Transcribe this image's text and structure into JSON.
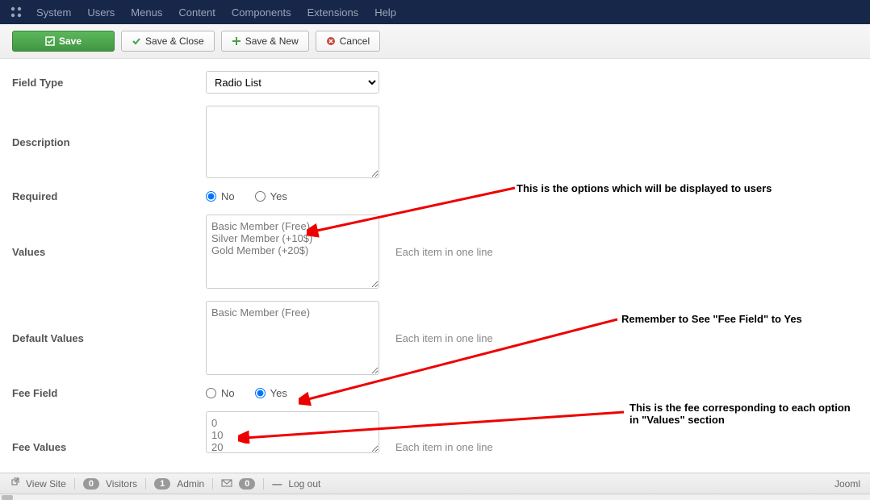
{
  "topmenu": [
    "System",
    "Users",
    "Menus",
    "Content",
    "Components",
    "Extensions",
    "Help"
  ],
  "toolbar": {
    "save": "Save",
    "save_close": "Save & Close",
    "save_new": "Save & New",
    "cancel": "Cancel"
  },
  "form": {
    "field_type_label": "Field Type",
    "field_type_value": "Radio List",
    "description_label": "Description",
    "description_value": "",
    "required_label": "Required",
    "radio_no": "No",
    "radio_yes": "Yes",
    "values_label": "Values",
    "values_value": "Basic Member (Free)\nSilver Member (+10$)\nGold Member (+20$)",
    "hint_each": "Each item in one line",
    "default_label": "Default Values",
    "default_value": "Basic Member (Free)",
    "fee_field_label": "Fee Field",
    "fee_values_label": "Fee Values",
    "fee_values_value": "0\n10\n20"
  },
  "annotations": {
    "a1": "This is the options which will be displayed to users",
    "a2": "Remember to See \"Fee Field\" to Yes",
    "a3": "This is the fee corresponding to each option in \"Values\" section"
  },
  "status": {
    "view_site": "View Site",
    "visitors_count": "0",
    "visitors": "Visitors",
    "admin_count": "1",
    "admin": "Admin",
    "msg_count": "0",
    "logout": "Log out",
    "brand": "Jooml"
  }
}
